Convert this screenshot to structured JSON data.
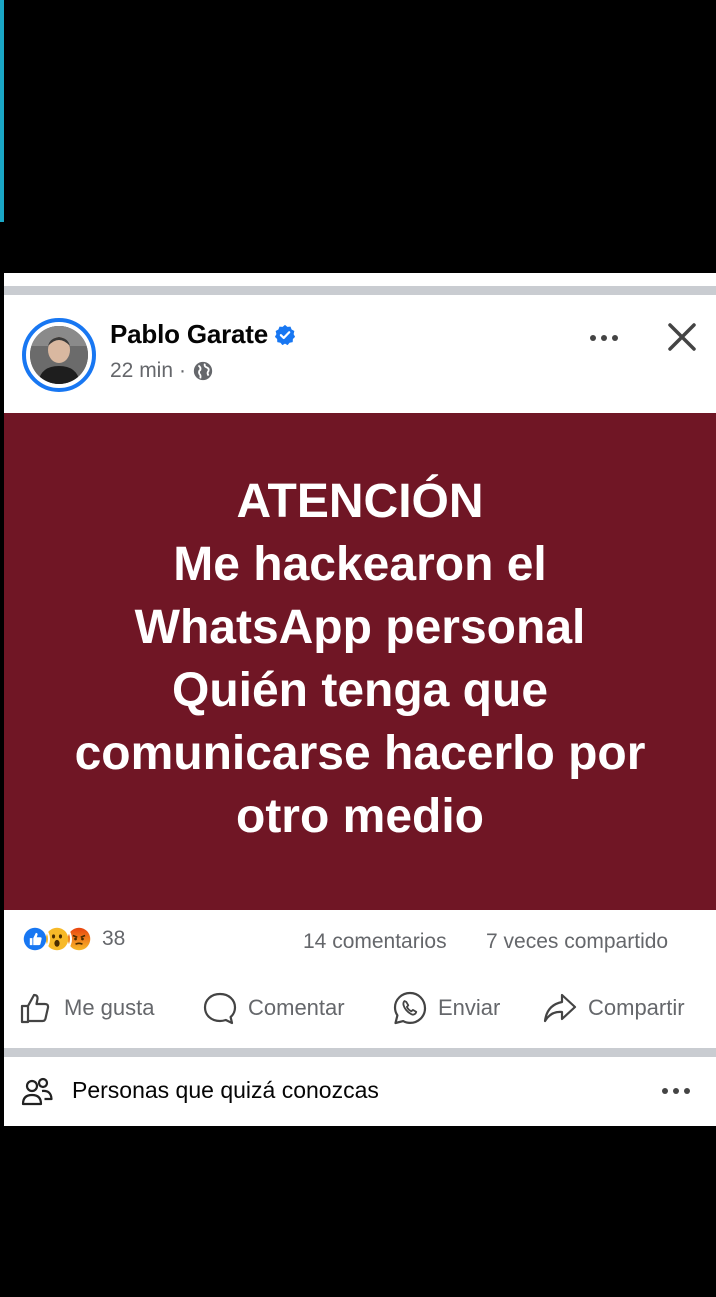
{
  "post": {
    "author_name": "Pablo Garate",
    "verified": true,
    "time": "22 min",
    "separator": "·",
    "privacy_icon": "globe-icon",
    "banner": {
      "background": "#701625",
      "lines": [
        "ATENCIÓN",
        "Me hackearon el",
        "WhatsApp personal",
        "Quién tenga que",
        "comunicarse hacerlo por",
        "otro medio"
      ]
    },
    "reactions": {
      "icons": [
        "like-icon",
        "wow-icon",
        "angry-icon"
      ],
      "count": "38"
    },
    "comments_label": "14 comentarios",
    "shares_label": "7 veces compartido",
    "actions": {
      "like": "Me gusta",
      "comment": "Comentar",
      "send": "Enviar",
      "share": "Compartir"
    }
  },
  "pymk": {
    "title": "Personas que quizá conozcas"
  },
  "colors": {
    "accent": "#1877f2",
    "text_secondary": "#65676b",
    "separator": "#c9ccd1"
  }
}
